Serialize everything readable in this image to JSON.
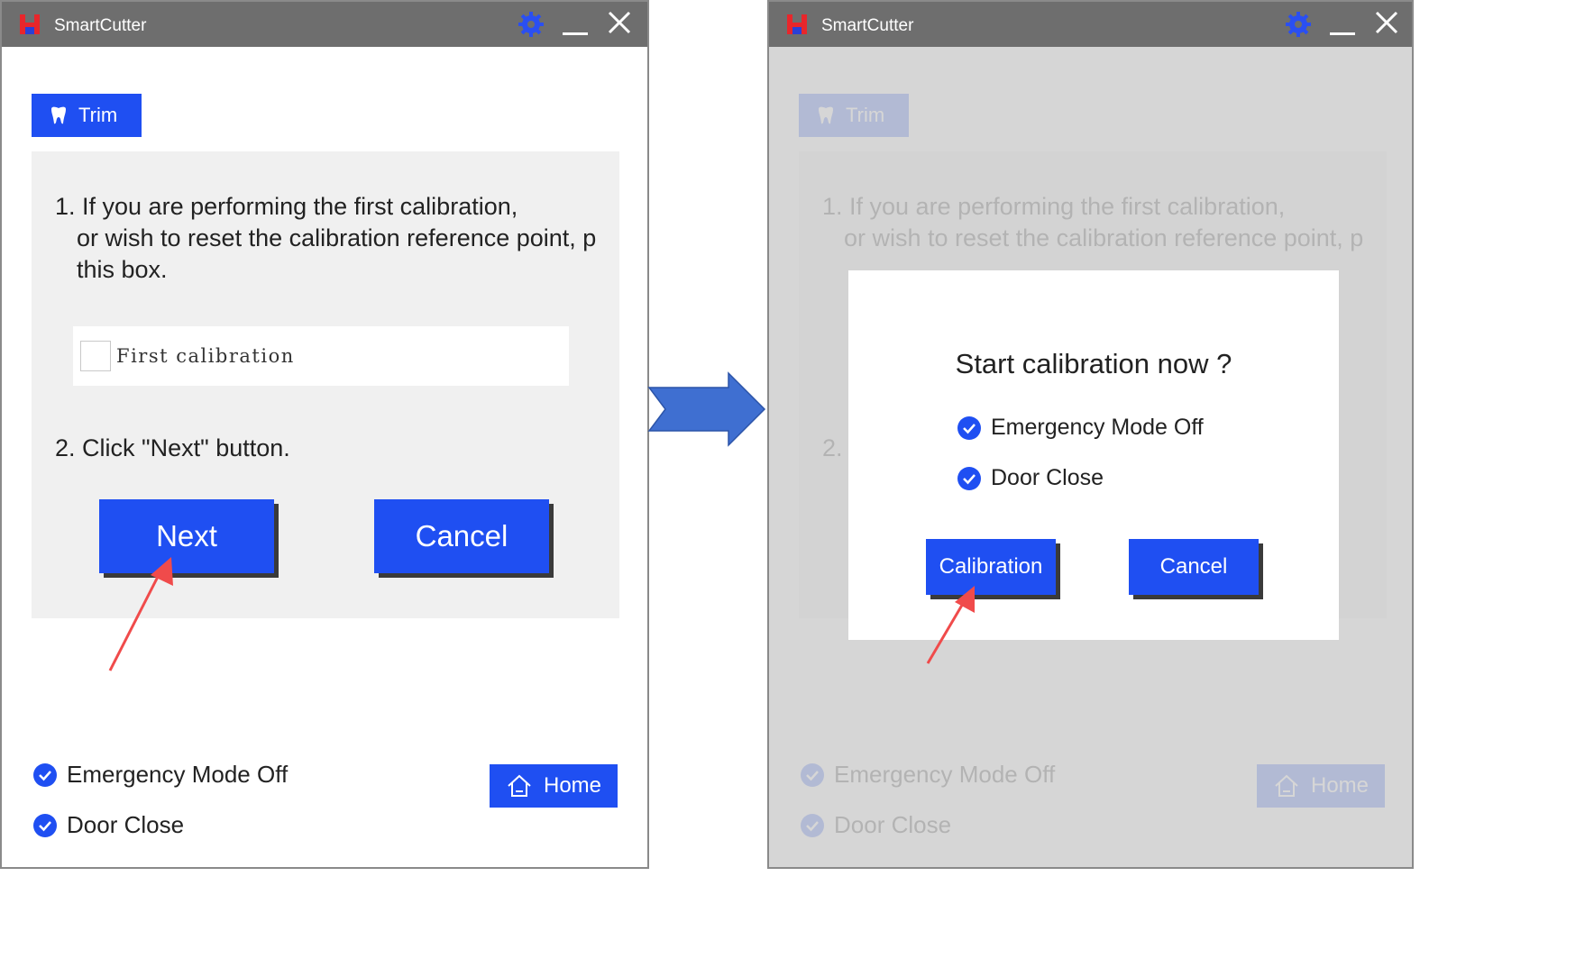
{
  "app": {
    "title": "SmartCutter"
  },
  "trim_tab": {
    "label": "Trim"
  },
  "panel": {
    "step1_line1": "1. If you are performing the first calibration,",
    "step1_line2": "or wish to reset the calibration reference point, p",
    "step1_line3": "this box.",
    "checkbox_label": "First calibration",
    "step2": "2. Click \"Next\" button.",
    "next_label": "Next",
    "cancel_label": "Cancel",
    "step2_partial": "2."
  },
  "status": {
    "emergency": "Emergency Mode Off",
    "door": "Door Close"
  },
  "home": {
    "label": "Home"
  },
  "dialog": {
    "title": "Start calibration now ?",
    "emergency": "Emergency Mode Off",
    "door": "Door Close",
    "calibration_label": "Calibration",
    "cancel_label": "Cancel"
  },
  "colors": {
    "accent": "#1f4ff2",
    "titlebar": "#6e6e6e",
    "annotation": "#f04b4b",
    "flow_arrow": "#3f6fd1"
  }
}
